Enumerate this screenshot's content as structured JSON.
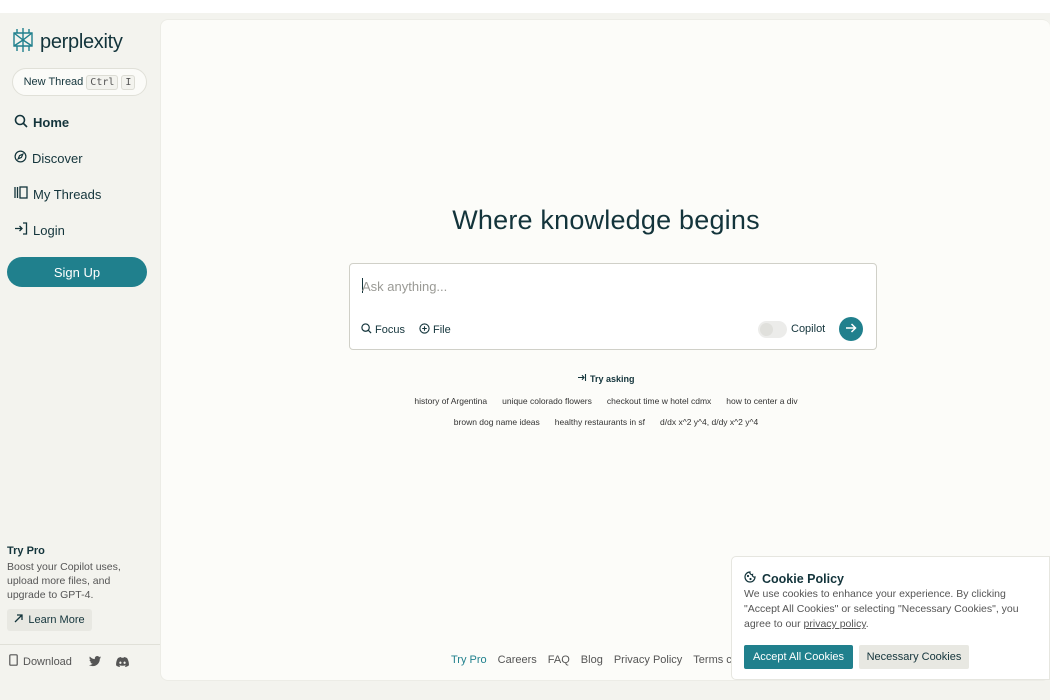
{
  "app": {
    "logo_text": "perplexity"
  },
  "sidebar": {
    "new_thread": {
      "label": "New Thread",
      "kbd1": "Ctrl",
      "kbd2": "I"
    },
    "nav": [
      {
        "label": "Home",
        "icon": "search-icon"
      },
      {
        "label": "Discover",
        "icon": "compass-icon"
      },
      {
        "label": "My Threads",
        "icon": "library-icon"
      },
      {
        "label": "Login",
        "icon": "login-icon"
      }
    ],
    "signup_label": "Sign Up",
    "try_pro": {
      "title": "Try Pro",
      "description": "Boost your Copilot uses, upload more files, and upgrade to GPT-4.",
      "learn_more": "Learn More"
    },
    "footer": {
      "download": "Download",
      "twitter_icon": "twitter-icon",
      "discord_icon": "discord-icon"
    }
  },
  "main": {
    "headline": "Where knowledge begins",
    "ask": {
      "placeholder": "Ask anything...",
      "value": ""
    },
    "tools": {
      "focus": "Focus",
      "file": "File",
      "copilot": "Copilot",
      "copilot_enabled": false
    },
    "try_asking": "Try asking",
    "suggestions_row1": [
      "history of Argentina",
      "unique colorado flowers",
      "checkout time w hotel cdmx",
      "how to center a div"
    ],
    "suggestions_row2": [
      "brown dog name ideas",
      "healthy restaurants in sf",
      "d/dx x^2 y^4, d/dy x^2 y^4"
    ],
    "footer_links": [
      "Try Pro",
      "Careers",
      "FAQ",
      "Blog",
      "Privacy Policy",
      "Terms c"
    ]
  },
  "cookie": {
    "title": "Cookie Policy",
    "text": "We use cookies to enhance your experience. By clicking \"Accept All Cookies\" or selecting \"Necessary Cookies\", you agree to our ",
    "link": "privacy policy",
    "text_end": ".",
    "accept": "Accept All Cookies",
    "necessary": "Necessary Cookies"
  },
  "colors": {
    "accent": "#20808d",
    "text": "#13343b",
    "background": "#f3f3ee"
  }
}
